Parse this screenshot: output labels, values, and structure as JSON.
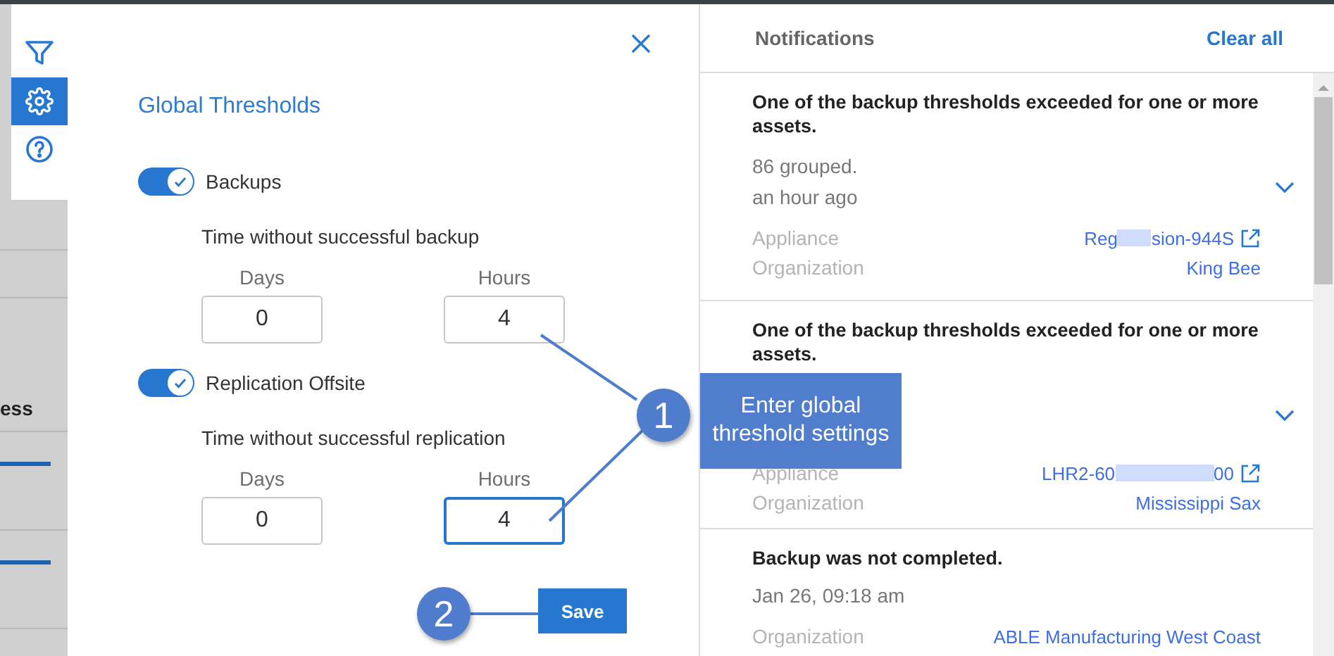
{
  "sidebar": {
    "items": [
      {
        "kind": "filter",
        "selected": false
      },
      {
        "kind": "settings",
        "selected": true
      },
      {
        "kind": "help",
        "selected": false
      }
    ]
  },
  "background_table": {
    "column_1_heading": "ess"
  },
  "panel": {
    "title": "Global Thresholds",
    "sections": [
      {
        "label": "Backups",
        "on": true,
        "subtitle": "Time without successful backup",
        "fields": [
          {
            "label": "Days",
            "value": "0",
            "focused": false
          },
          {
            "label": "Hours",
            "value": "4",
            "focused": false
          }
        ]
      },
      {
        "label": "Replication Offsite",
        "on": true,
        "subtitle": "Time without successful replication",
        "fields": [
          {
            "label": "Days",
            "value": "0",
            "focused": false
          },
          {
            "label": "Hours",
            "value": "4",
            "focused": true
          }
        ]
      }
    ],
    "save_button": "Save"
  },
  "notifications": {
    "title": "Notifications",
    "clear_all": "Clear all",
    "items": [
      {
        "title": "One of the backup thresholds exceeded for one or more assets.",
        "grouped": "86 grouped.",
        "time": "an hour ago",
        "expandable": true,
        "fields": [
          {
            "label": "Appliance",
            "value_parts": [
              "Reg",
              "sion-944S"
            ],
            "external_link": true
          },
          {
            "label": "Organization",
            "value_parts": [
              "King Bee"
            ],
            "external_link": false
          }
        ]
      },
      {
        "title": "One of the backup thresholds exceeded for one or more assets.",
        "expandable": true,
        "fields": [
          {
            "label": "Appliance",
            "value_parts": [
              "LHR2-60",
              "00"
            ],
            "external_link": true
          },
          {
            "label": "Organization",
            "value_parts": [
              "Mississippi Sax"
            ],
            "external_link": false
          }
        ]
      },
      {
        "title": "Backup was not completed.",
        "time": "Jan 26, 09:18 am",
        "expandable": false,
        "fields": [
          {
            "label": "Organization",
            "value_parts": [
              "ABLE Manufacturing West Coast"
            ],
            "external_link": false
          }
        ]
      }
    ]
  },
  "callouts": [
    {
      "number": "1",
      "text": "Enter global threshold settings"
    },
    {
      "number": "2"
    }
  ]
}
